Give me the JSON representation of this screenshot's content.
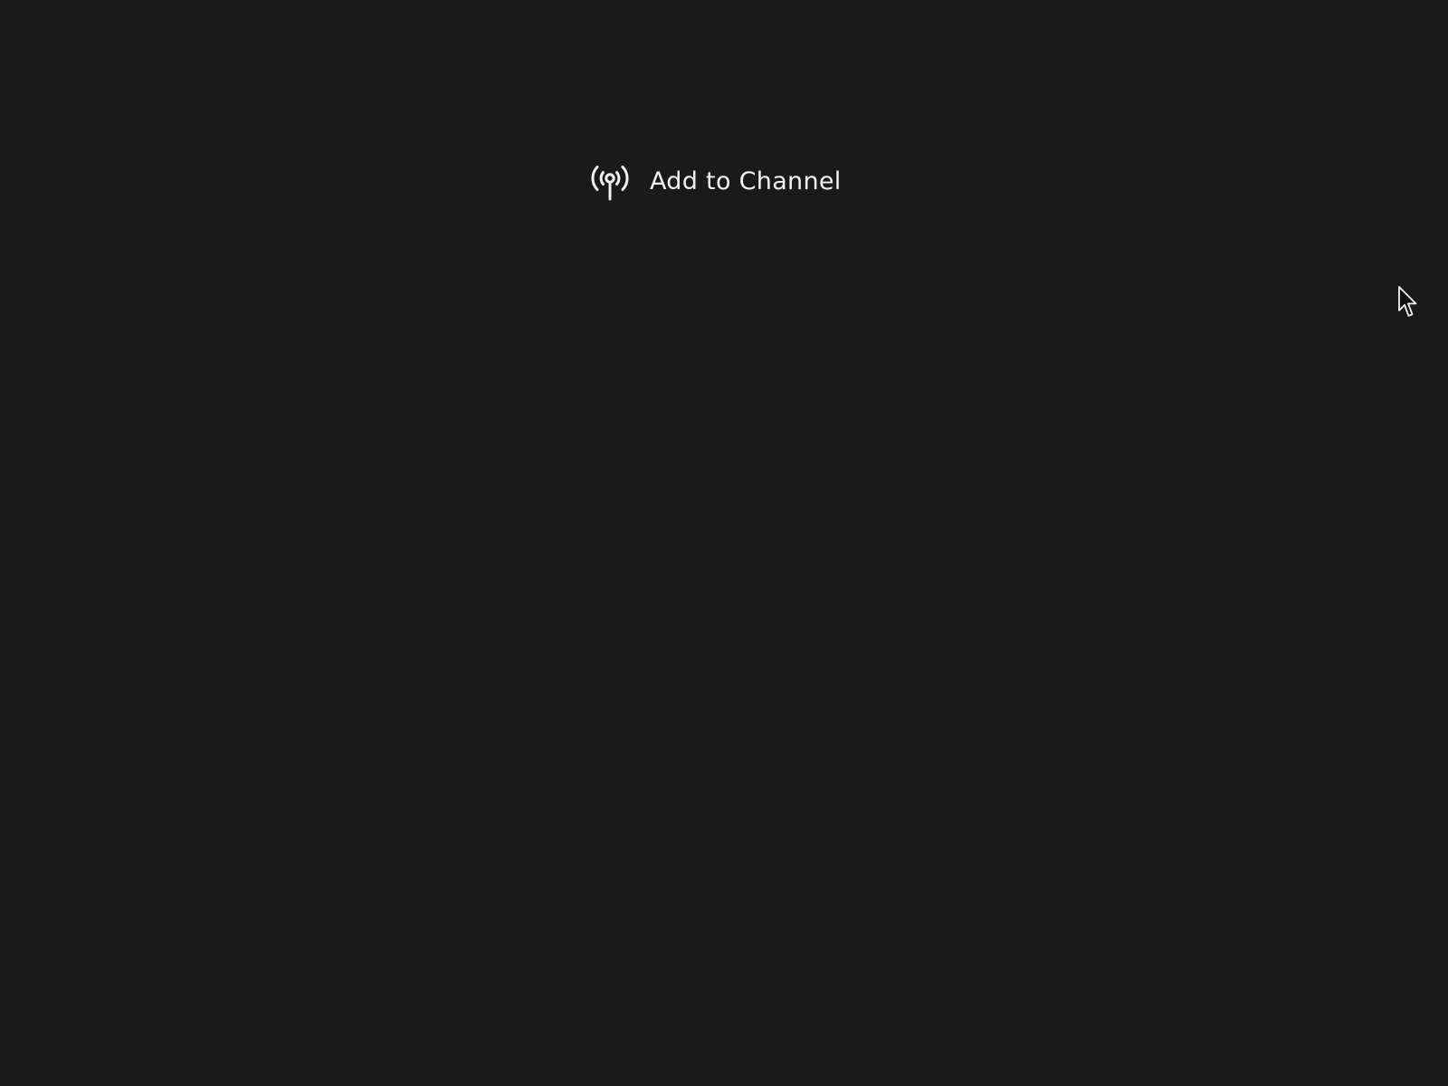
{
  "background_color": "#1a1a1a",
  "action": {
    "label": "Add to Channel",
    "icon": "broadcast-antenna-icon",
    "color": "#f2f2f2"
  },
  "cursor": {
    "icon": "mouse-pointer-icon"
  }
}
